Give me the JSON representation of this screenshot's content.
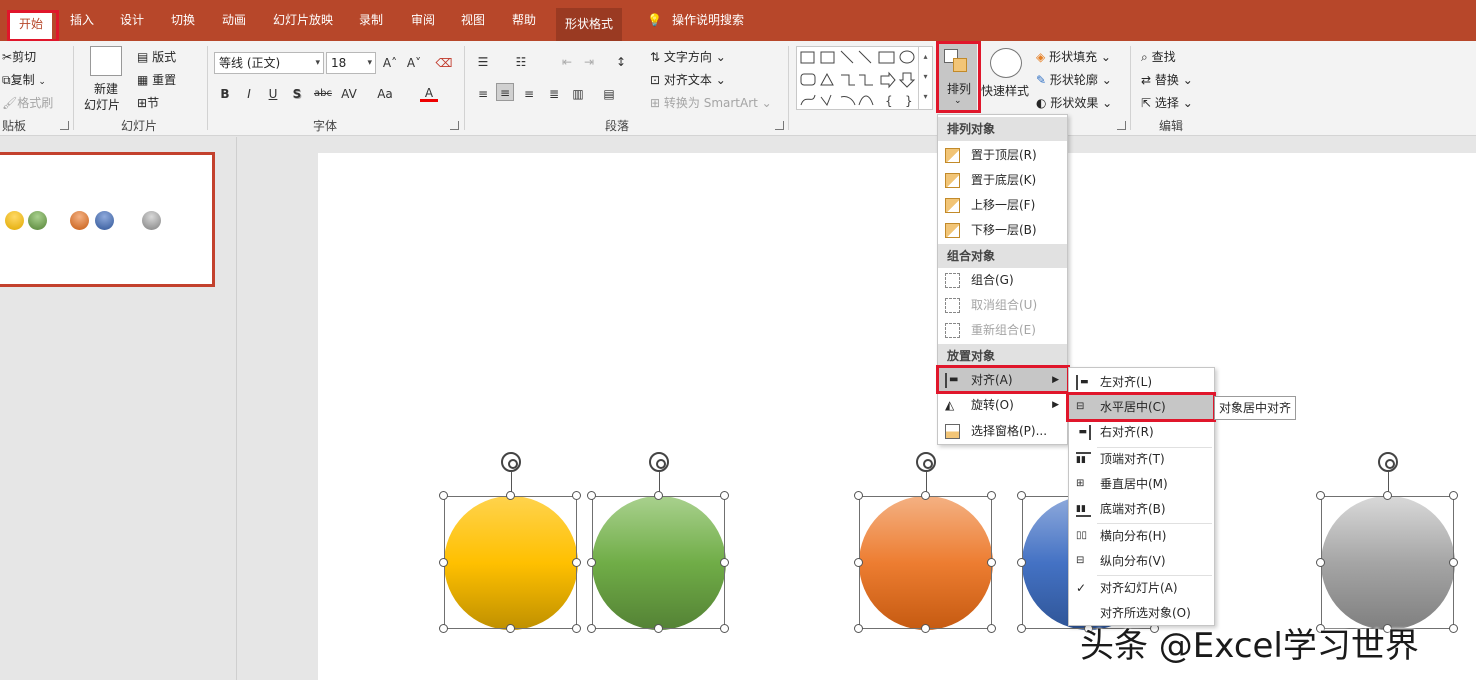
{
  "tabs": [
    "开始",
    "插入",
    "设计",
    "切换",
    "动画",
    "幻灯片放映",
    "录制",
    "审阅",
    "视图",
    "帮助",
    "形状格式"
  ],
  "tell_me": "操作说明搜索",
  "clipboard": {
    "cut": "剪切",
    "copy": "复制",
    "format_painter": "格式刷",
    "group_label": "贴板"
  },
  "slides": {
    "new_slide": "新建",
    "new_slide2": "幻灯片",
    "layout": "版式",
    "reset": "重置",
    "section": "节",
    "group_label": "幻灯片"
  },
  "font": {
    "name": "等线 (正文)",
    "size": "18",
    "group_label": "字体",
    "bold": "B",
    "italic": "I",
    "underline": "U",
    "shadow": "S",
    "strike": "abc",
    "spacing": "AV",
    "case": "Aa",
    "color": "A"
  },
  "paragraph": {
    "text_direction": "文字方向",
    "align_text": "对齐文本",
    "smartart": "转换为 SmartArt",
    "group_label": "段落"
  },
  "drawing": {
    "arrange": "排列",
    "quick_styles": "快速样式",
    "shape_fill": "形状填充",
    "shape_outline": "形状轮廓",
    "shape_effects": "形状效果"
  },
  "editing": {
    "find": "查找",
    "replace": "替换",
    "select": "选择",
    "group_label": "编辑"
  },
  "arrange_menu": {
    "header_order": "排列对象",
    "bring_front": "置于顶层(R)",
    "send_back": "置于底层(K)",
    "bring_forward": "上移一层(F)",
    "send_backward": "下移一层(B)",
    "header_group": "组合对象",
    "group": "组合(G)",
    "ungroup": "取消组合(U)",
    "regroup": "重新组合(E)",
    "header_position": "放置对象",
    "align": "对齐(A)",
    "rotate": "旋转(O)",
    "selection_pane": "选择窗格(P)..."
  },
  "align_menu": {
    "left": "左对齐(L)",
    "center": "水平居中(C)",
    "right": "右对齐(R)",
    "top": "顶端对齐(T)",
    "middle": "垂直居中(M)",
    "bottom": "底端对齐(B)",
    "dist_h": "横向分布(H)",
    "dist_v": "纵向分布(V)",
    "to_slide": "对齐幻灯片(A)",
    "to_selected": "对齐所选对象(O)",
    "check": "✓"
  },
  "tooltip": "对象居中对齐",
  "watermark": "头条 @Excel学习世界",
  "colors": {
    "ribbon_accent": "#b7472a",
    "highlight_box": "#e0162b",
    "yellow": "#ffc000",
    "green": "#70ad47",
    "orange": "#ed7d31",
    "blue": "#4472c4",
    "gray": "#a5a5a5"
  }
}
